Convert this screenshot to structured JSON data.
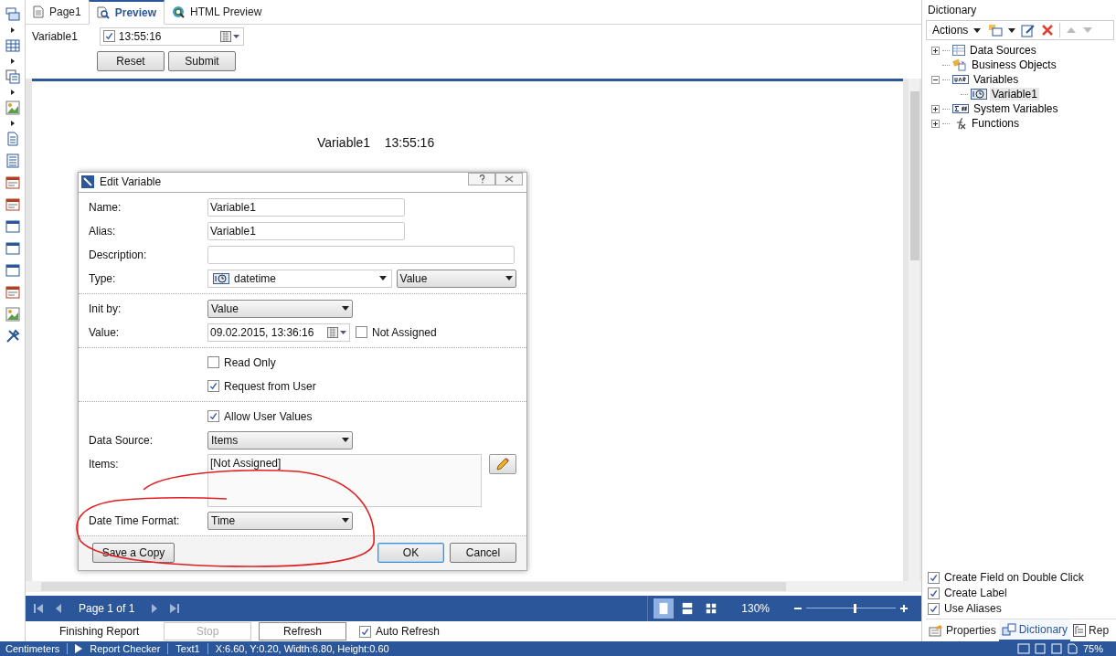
{
  "tabs": [
    {
      "label": "Page1",
      "kind": "page",
      "selected": false
    },
    {
      "label": "Preview",
      "kind": "preview",
      "selected": true
    },
    {
      "label": "HTML Preview",
      "kind": "html",
      "selected": false
    }
  ],
  "parameter": {
    "label": "Variable1",
    "checked": true,
    "value": "13:55:16"
  },
  "parameter_buttons": [
    "Reset",
    "Submit"
  ],
  "report": {
    "label": "Variable1",
    "value": "13:55:16"
  },
  "dialog": {
    "title": "Edit Variable",
    "sections": [
      [
        {
          "kind": "text",
          "label": "Name:",
          "value": "Variable1",
          "wide": false
        },
        {
          "kind": "text",
          "label": "Alias:",
          "value": "Variable1",
          "wide": false
        },
        {
          "kind": "text",
          "label": "Description:",
          "wide": true
        },
        {
          "kind": "type",
          "label": "Type:",
          "value": "datetime",
          "mode": "Value"
        }
      ],
      [
        {
          "kind": "select",
          "label": "Init by:",
          "value": "Value"
        },
        {
          "kind": "date",
          "label": "Value:",
          "value": "09.02.2015, 13:36:16",
          "option": {
            "label": "Not Assigned",
            "checked": false
          }
        }
      ],
      [
        {
          "kind": "check",
          "label": "Read Only",
          "checked": false
        },
        {
          "kind": "check",
          "label": "Request from User",
          "checked": true
        }
      ],
      [
        {
          "kind": "check",
          "label": "Allow User Values",
          "checked": true
        },
        {
          "kind": "select",
          "label": "Data Source:",
          "value": "Items"
        },
        {
          "kind": "list",
          "label": "Items:",
          "value": "[Not Assigned]"
        },
        {
          "kind": "select",
          "label": "Date Time Format:",
          "value": "Time"
        }
      ]
    ],
    "buttons": [
      {
        "label": "Save a Copy",
        "default": false
      },
      {
        "label": "OK",
        "default": true
      },
      {
        "label": "Cancel",
        "default": false
      }
    ]
  },
  "navigation": {
    "page": "Page 1 of 1",
    "views": [
      {
        "kind": "single",
        "selected": true
      },
      {
        "kind": "double",
        "selected": false
      },
      {
        "kind": "grid",
        "selected": false
      }
    ],
    "zoom": "130%",
    "level": 0.54
  },
  "progress": {
    "status": "Finishing Report",
    "buttons": [
      {
        "label": "Stop",
        "disabled": true
      },
      {
        "label": "Refresh",
        "disabled": false
      }
    ],
    "auto_refresh": {
      "label": "Auto Refresh",
      "checked": true
    }
  },
  "dictionary": {
    "title": "Dictionary",
    "actions": "Actions",
    "tree": [
      {
        "label": "Data Sources",
        "kind": "datasource",
        "expanded": false,
        "selected": false
      },
      {
        "label": "Business Objects",
        "kind": "business",
        "selected": false
      },
      {
        "label": "Variables",
        "kind": "variables",
        "expanded": true,
        "selected": false,
        "children": [
          {
            "label": "Variable1",
            "kind": "datetime",
            "selected": true
          }
        ]
      },
      {
        "label": "System Variables",
        "kind": "system",
        "expanded": false,
        "selected": false
      },
      {
        "label": "Functions",
        "kind": "functions",
        "expanded": false,
        "selected": false
      }
    ],
    "options": [
      {
        "label": "Create Field on Double Click",
        "checked": true
      },
      {
        "label": "Create Label",
        "checked": true
      },
      {
        "label": "Use Aliases",
        "checked": true
      }
    ],
    "tabs": [
      {
        "label": "Properties",
        "kind": "properties",
        "selected": false
      },
      {
        "label": "Dictionary",
        "kind": "dictionary",
        "selected": true
      },
      {
        "label": "Rep",
        "kind": "report",
        "selected": false
      }
    ]
  },
  "status_bar": {
    "unit": "Centimeters",
    "checker": "Report Checker",
    "component": "Text1",
    "position": "X:6.60, Y:0.20, Width:6.80, Height:0.60",
    "zoom": "75%"
  }
}
